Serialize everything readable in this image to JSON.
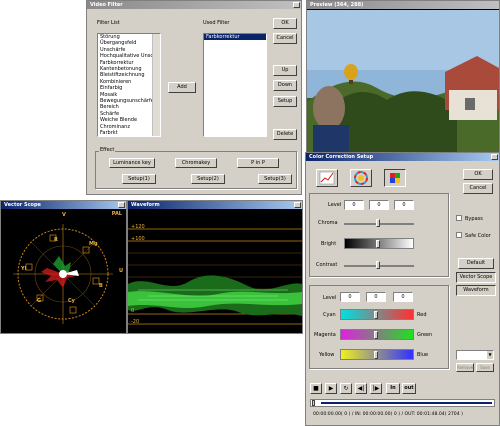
{
  "video_filter": {
    "title": "Video Filter",
    "filter_list_label": "Filter List",
    "filter_list": [
      "Störung",
      "Übergangsfeld",
      "Unschärfe",
      "Hochqualitative Unschä",
      "Farbkorrektur",
      "Kantenbetonung",
      "Bleistiftzeichnung",
      "Kombinieren",
      "Einfarbig",
      "Mosaik",
      "Bewegungsunschärfe",
      "Bereich",
      "Schärfe",
      "Weiche Blende",
      "Chrominanz",
      "Farbrkt"
    ],
    "used_filter_label": "Used Filter",
    "used_filter": [
      "Farbkorrektur"
    ],
    "add": "Add",
    "ok": "OK",
    "cancel": "Cancel",
    "up": "Up",
    "down": "Down",
    "setup": "Setup",
    "delete": "Delete",
    "effect_label": "Effect",
    "luminance_key": "Luminance key",
    "chromakey": "Chromakey",
    "pinp": "P in P",
    "setup1": "Setup(1)",
    "setup2": "Setup(2)",
    "setup3": "Setup(3)"
  },
  "preview": {
    "title": "Preview (364, 288)"
  },
  "vector_scope": {
    "title": "Vector Scope",
    "pal": "PAL",
    "labels": {
      "v": "V",
      "u": "U",
      "r": "R",
      "mg": "Mg",
      "yl": "Yl",
      "b": "B",
      "g": "G",
      "cy": "Cy"
    }
  },
  "waveform": {
    "title": "Waveform",
    "ticks": [
      "+120",
      "+100",
      "0",
      "-20"
    ]
  },
  "color_correction": {
    "title": "Color Correction Setup",
    "ok": "OK",
    "cancel": "Cancel",
    "level_label": "Level",
    "level_values": [
      "0",
      "0",
      "0"
    ],
    "chroma": "Chroma",
    "bright": "Bright",
    "contrast": "Contrast",
    "bypass": "Bypass",
    "safe_color": "Safe Color",
    "default": "Default",
    "vector_scope_btn": "Vector Scope",
    "waveform_btn": "Waveform",
    "level2_label": "Level",
    "level2_values": [
      "0",
      "0",
      "0"
    ],
    "cyan": "Cyan",
    "red": "Red",
    "magenta": "Magenta",
    "green": "Green",
    "yellow": "Yellow",
    "blue": "Blue",
    "small_btn1": "Remove",
    "small_btn2": "Save"
  },
  "timeline": {
    "in": "In",
    "out": "out",
    "timecode": "00:00:00.00( 0 ) / IN: 00:00:00.00( 0 ) / OUT: 00:01:48.04( 2704 )"
  }
}
